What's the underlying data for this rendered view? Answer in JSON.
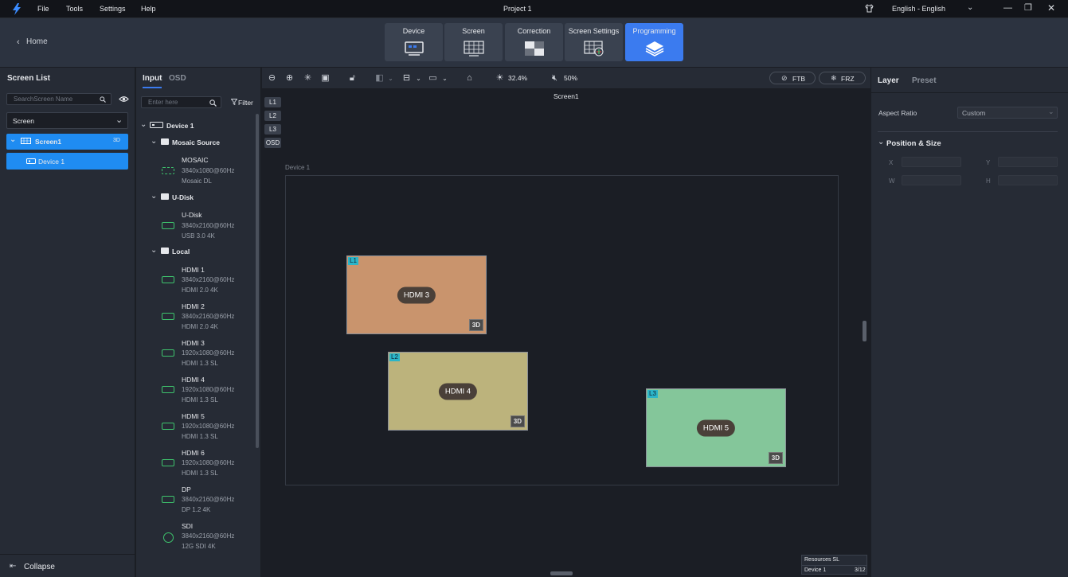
{
  "app": {
    "title": "Project 1",
    "menu": [
      "File",
      "Tools",
      "Settings",
      "Help"
    ],
    "language": "English - English",
    "colors": {
      "accent": "#3b7bef",
      "selected": "#1f8cf2"
    }
  },
  "nav": {
    "home": "Home",
    "tabs": [
      {
        "label": "Device",
        "icon": "device-icon"
      },
      {
        "label": "Screen",
        "icon": "screen-grid-icon"
      },
      {
        "label": "Correction",
        "icon": "correction-icon"
      },
      {
        "label": "Screen Settings",
        "icon": "screen-settings-icon"
      },
      {
        "label": "Programming",
        "icon": "layers-icon",
        "active": true
      }
    ]
  },
  "screen_list": {
    "title": "Screen List",
    "search_placeholder": "SearchScreen Name",
    "filter_select": "Screen",
    "screen_name": "Screen1",
    "screen_badge": "3D",
    "device_name": "Device 1",
    "collapse": "Collapse"
  },
  "input_panel": {
    "tabs": [
      "Input",
      "OSD"
    ],
    "search_placeholder": "Enter here",
    "filter": "Filter",
    "device": "Device 1",
    "groups": [
      {
        "name": "Mosaic Source",
        "items": [
          {
            "name": "MOSAIC",
            "res": "3840x1080@60Hz",
            "type": "Mosaic DL"
          }
        ]
      },
      {
        "name": "U-Disk",
        "items": [
          {
            "name": "U-Disk",
            "res": "3840x2160@60Hz",
            "type": "USB 3.0 4K"
          }
        ]
      },
      {
        "name": "Local",
        "items": [
          {
            "name": "HDMI 1",
            "res": "3840x2160@60Hz",
            "type": "HDMI 2.0 4K"
          },
          {
            "name": "HDMI 2",
            "res": "3840x2160@60Hz",
            "type": "HDMI 2.0 4K"
          },
          {
            "name": "HDMI 3",
            "res": "1920x1080@60Hz",
            "type": "HDMI 1.3 SL"
          },
          {
            "name": "HDMI 4",
            "res": "1920x1080@60Hz",
            "type": "HDMI 1.3 SL"
          },
          {
            "name": "HDMI 5",
            "res": "1920x1080@60Hz",
            "type": "HDMI 1.3 SL"
          },
          {
            "name": "HDMI 6",
            "res": "1920x1080@60Hz",
            "type": "HDMI 1.3 SL"
          },
          {
            "name": "DP",
            "res": "3840x2160@60Hz",
            "type": "DP 1.2 4K"
          },
          {
            "name": "SDI",
            "res": "3840x2160@60Hz",
            "type": "12G SDI 4K"
          }
        ]
      }
    ]
  },
  "toolbar": {
    "brightness": "32.4%",
    "volume": "50%",
    "ftb": "FTB",
    "frz": "FRZ"
  },
  "canvas": {
    "screen_title": "Screen1",
    "device_label": "Device 1",
    "layer_buttons": [
      "L1",
      "L2",
      "L3",
      "OSD"
    ],
    "layers": [
      {
        "tag": "L1",
        "source": "HDMI 3",
        "badge": "3D",
        "color": "#c9946d"
      },
      {
        "tag": "L2",
        "source": "HDMI 4",
        "badge": "3D",
        "color": "#bcb37c"
      },
      {
        "tag": "L3",
        "source": "HDMI 5",
        "badge": "3D",
        "color": "#84c69a"
      }
    ],
    "resources": {
      "title": "Resources SL",
      "device": "Device 1",
      "count": "3/12"
    }
  },
  "right_panel": {
    "tabs": [
      "Layer",
      "Preset"
    ],
    "aspect_label": "Aspect Ratio",
    "aspect_value": "Custom",
    "section": "Position & Size",
    "fields": [
      "X",
      "Y",
      "W",
      "H"
    ]
  }
}
